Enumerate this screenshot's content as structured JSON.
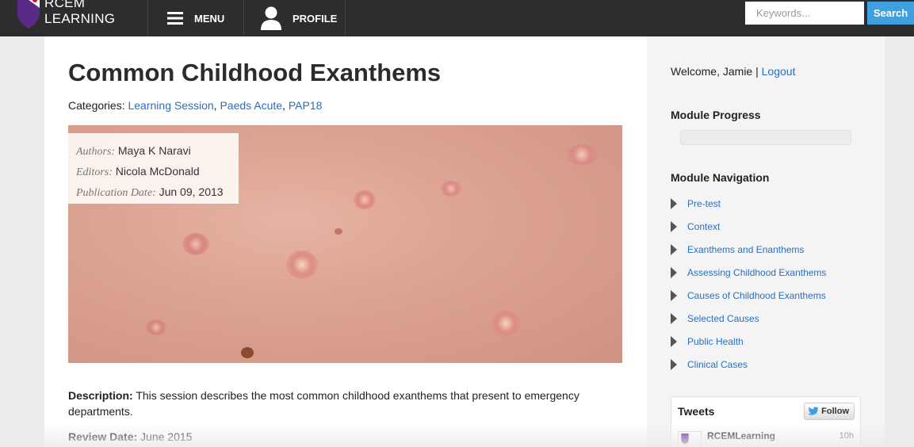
{
  "header": {
    "logo_text_line1": "RCEM",
    "logo_text_line2": "LEARNING",
    "menu_label": "MENU",
    "profile_label": "PROFILE",
    "search": {
      "placeholder": "Keywords...",
      "button_label": "Search"
    }
  },
  "article": {
    "title": "Common Childhood Exanthems",
    "categories_label": "Categories:",
    "categories": [
      "Learning Session",
      "Paeds Acute",
      "PAP18"
    ],
    "authors_label": "Authors:",
    "authors": "Maya K Naravi",
    "editors_label": "Editors:",
    "editors": "Nicola McDonald",
    "pubdate_label": "Publication Date:",
    "pubdate": "Jun 09, 2013",
    "description_label": "Description:",
    "description": "This session describes the most common childhood exanthems that present to emergency departments.",
    "review_label": "Review Date:",
    "review_date": "June 2015"
  },
  "sidebar": {
    "welcome": "Welcome, Jamie |",
    "logout_label": "Logout",
    "progress_heading": "Module Progress",
    "progress_fraction": 0,
    "nav_heading": "Module Navigation",
    "nav_items": [
      "Pre-test",
      "Context",
      "Exanthems and Enanthems",
      "Assessing Childhood Exanthems",
      "Causes of Childhood Exanthems",
      "Selected Causes",
      "Public Health",
      "Clinical Cases"
    ],
    "tweets": {
      "title": "Tweets",
      "follow_label": "Follow",
      "user": "RCEMLearning",
      "time": "10h"
    }
  },
  "colors": {
    "topbar": "#2d2d2d",
    "link": "#2a6fc0",
    "accent": "#3fa0e0"
  }
}
